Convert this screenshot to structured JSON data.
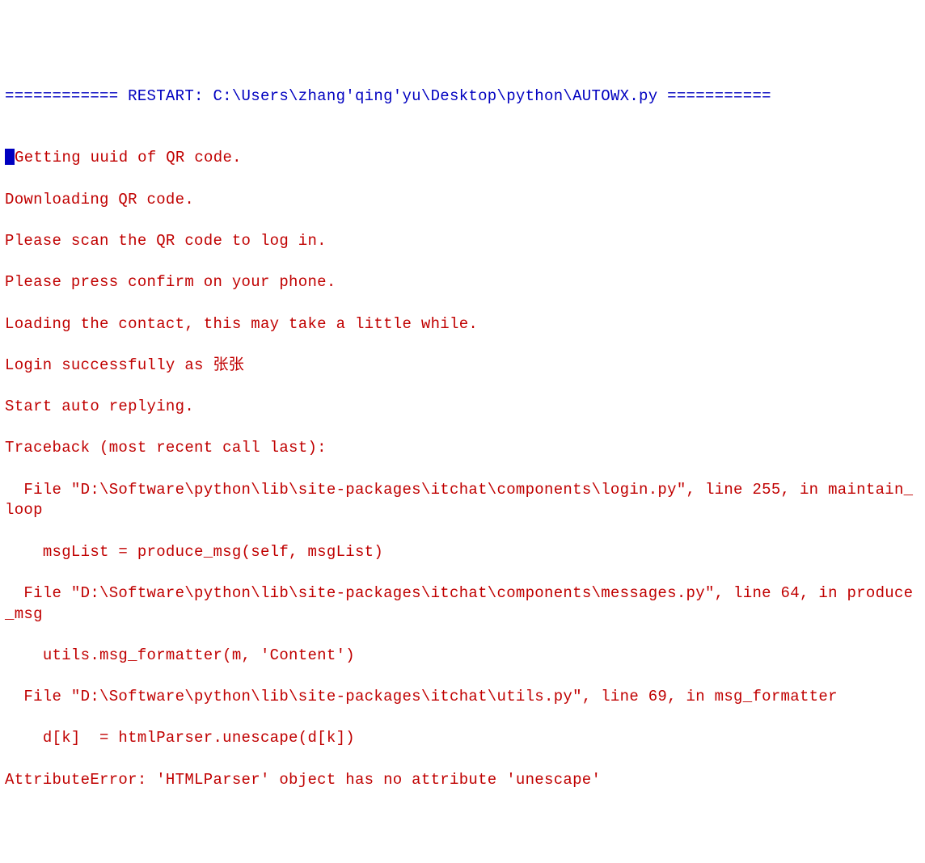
{
  "restart_line": "============ RESTART: C:\\Users\\zhang'qing'yu\\Desktop\\python\\AUTOWX.py ===========",
  "output": {
    "line1": "Getting uuid of QR code.",
    "line2": "Downloading QR code.",
    "line3": "Please scan the QR code to log in.",
    "line4": "Please press confirm on your phone.",
    "line5": "Loading the contact, this may take a little while.",
    "line6": "Login successfully as 张张",
    "line7": "Start auto replying.",
    "line8": "Traceback (most recent call last):",
    "line9": "  File \"D:\\Software\\python\\lib\\site-packages\\itchat\\components\\login.py\", line 255, in maintain_loop",
    "line10": "    msgList = produce_msg(self, msgList)",
    "line11": "  File \"D:\\Software\\python\\lib\\site-packages\\itchat\\components\\messages.py\", line 64, in produce_msg",
    "line12": "    utils.msg_formatter(m, 'Content')",
    "line13": "  File \"D:\\Software\\python\\lib\\site-packages\\itchat\\utils.py\", line 69, in msg_formatter",
    "line14": "    d[k]  = htmlParser.unescape(d[k])",
    "line15": "AttributeError: 'HTMLParser' object has no attribute 'unescape'"
  }
}
